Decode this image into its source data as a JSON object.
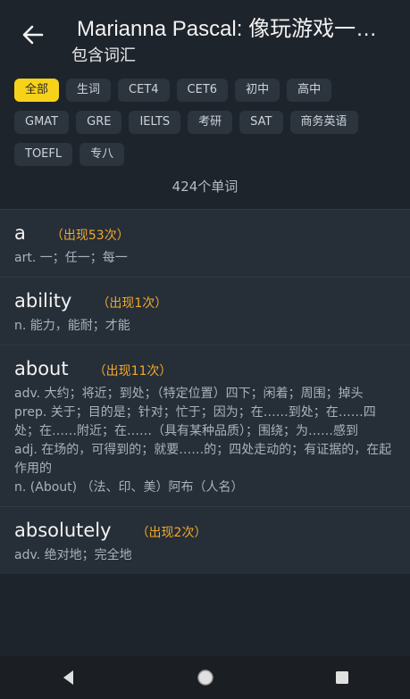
{
  "header": {
    "title": "Marianna Pascal: 像玩游戏一样学英语",
    "subtitle": "包含词汇"
  },
  "tags": {
    "row1": [
      "全部",
      "生词",
      "CET4",
      "CET6",
      "初中",
      "高中"
    ],
    "row2": [
      "GMAT",
      "GRE",
      "IELTS",
      "考研",
      "SAT",
      "商务英语"
    ],
    "row3": [
      "TOEFL",
      "专八"
    ],
    "active": "全部"
  },
  "word_count": "424个单词",
  "words": [
    {
      "word": "a",
      "freq": "（出现53次）",
      "defs": [
        "art. 一；任一；每一"
      ]
    },
    {
      "word": "ability",
      "freq": "（出现1次）",
      "defs": [
        "n. 能力，能耐；才能"
      ]
    },
    {
      "word": "about",
      "freq": "（出现11次）",
      "defs": [
        "adv. 大约；将近；到处；（特定位置）四下；闲着；周围；掉头",
        "prep. 关于；目的是；针对；忙于；因为；在……到处；在……四处；在……附近；在……（具有某种品质）；围绕；为……感到",
        "adj. 在场的，可得到的；就要……的；四处走动的；有证据的，在起作用的",
        "n. (About) （法、印、美）阿布（人名）"
      ]
    },
    {
      "word": "absolutely",
      "freq": "（出现2次）",
      "defs": [
        "adv. 绝对地；完全地"
      ]
    }
  ],
  "icons": {
    "back": "arrow-left-icon",
    "nav_back": "triangle-back-icon",
    "nav_home": "circle-home-icon",
    "nav_recent": "square-recent-icon"
  },
  "colors": {
    "accent": "#f7d21a",
    "freq": "#f0a92a",
    "background": "#1e242c",
    "card": "#262e38"
  }
}
